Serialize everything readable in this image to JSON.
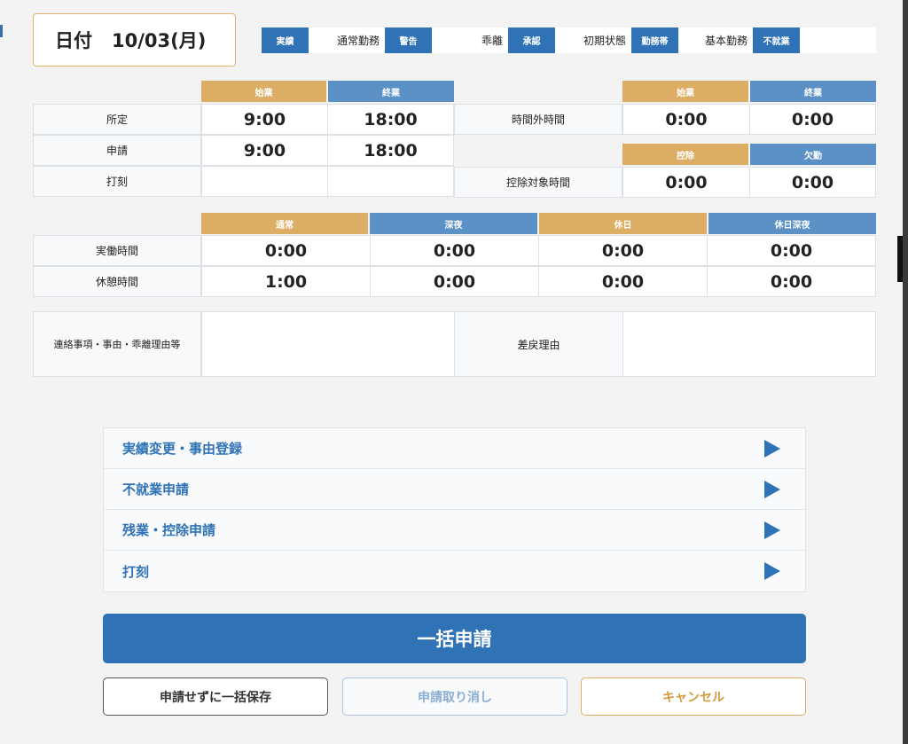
{
  "header": {
    "date_label": "日付",
    "date_value": "10/03(月)"
  },
  "status": {
    "jisseki_tag": "実績",
    "kinmu_text": "通常勤務",
    "keikoku_tag": "警告",
    "kairi_text": "乖離",
    "shonin_tag": "承認",
    "shoki_text": "初期状態",
    "kinmutai_tag": "勤務帯",
    "kihon_text": "基本勤務",
    "fushugyo_tag": "不就業"
  },
  "schedule": {
    "head_start": "始業",
    "head_end": "終業",
    "rows": [
      {
        "label": "所定",
        "start": "9:00",
        "end": "18:00"
      },
      {
        "label": "申請",
        "start": "9:00",
        "end": "18:00"
      },
      {
        "label": "打刻",
        "start": "",
        "end": ""
      }
    ]
  },
  "overtime": {
    "head_start": "始業",
    "head_end": "終業",
    "label": "時間外時間",
    "start": "0:00",
    "end": "0:00"
  },
  "deduction": {
    "head_kojo": "控除",
    "head_kekkin": "欠勤",
    "label": "控除対象時間",
    "kojo": "0:00",
    "kekkin": "0:00"
  },
  "work": {
    "headers": [
      "通常",
      "深夜",
      "休日",
      "休日深夜"
    ],
    "rows": [
      {
        "label": "実働時間",
        "values": [
          "0:00",
          "0:00",
          "0:00",
          "0:00"
        ]
      },
      {
        "label": "休憩時間",
        "values": [
          "1:00",
          "0:00",
          "0:00",
          "0:00"
        ]
      }
    ]
  },
  "notes": {
    "contact_label": "連絡事項・事由・乖離理由等",
    "contact_value": "",
    "return_label": "差戻理由",
    "return_value": ""
  },
  "accordion": [
    "実績変更・事由登録",
    "不就業申請",
    "残業・控除申請",
    "打刻"
  ],
  "buttons": {
    "bulk_apply": "一括申請",
    "save_without_apply": "申請せずに一括保存",
    "withdraw": "申請取り消し",
    "cancel": "キャンセル"
  },
  "colors": {
    "primary": "#2f72b5",
    "orange": "#dcae65",
    "header_blue": "#5b91c4"
  }
}
